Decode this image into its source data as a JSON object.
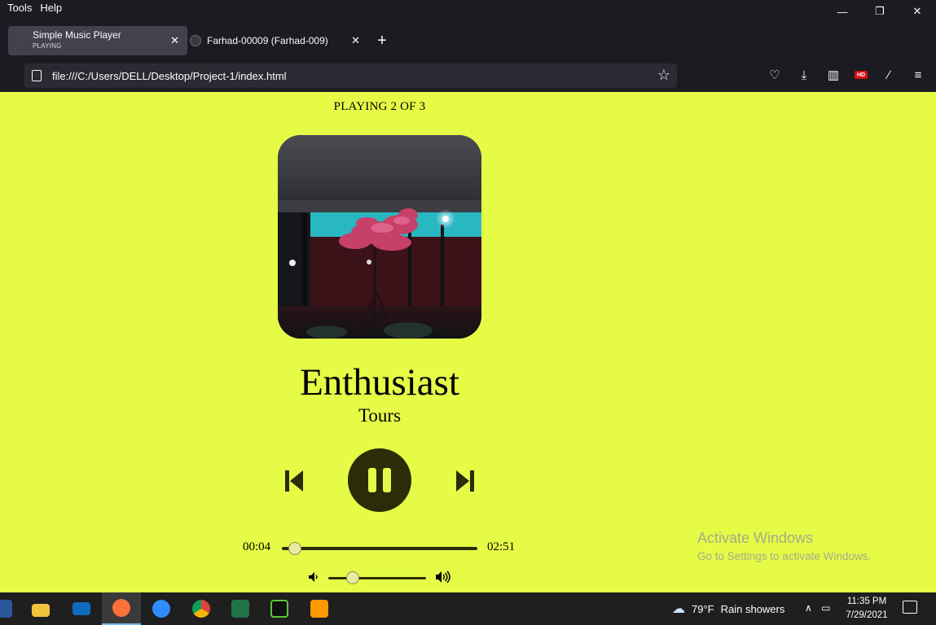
{
  "browser": {
    "menu": [
      "Tools",
      "Help"
    ],
    "tabs": [
      {
        "title": "Simple Music Player",
        "subtitle": "PLAYING"
      },
      {
        "title": "Farhad-00009 (Farhad-009)"
      }
    ],
    "url": "file:///C:/Users/DELL/Desktop/Project-1/index.html",
    "hd_badge": "HD"
  },
  "player": {
    "now_playing": "PLAYING 2 OF 3",
    "track_name": "Enthusiast",
    "artist": "Tours",
    "current_time": "00:04",
    "total_time": "02:51",
    "seek_progress": 0.05,
    "volume_level": 0.25,
    "state": "playing",
    "colors": {
      "background": "#e5fb46",
      "controls": "#2b2d08"
    }
  },
  "watermark": {
    "line1": "Activate Windows",
    "line2": "Go to Settings to activate Windows."
  },
  "taskbar": {
    "apps": [
      "word-icon",
      "file-explorer-icon",
      "mail-icon",
      "firefox-icon",
      "zoom-icon",
      "chrome-icon",
      "excel-icon",
      "terminal-icon",
      "sublime-text-icon"
    ],
    "weather_temp": "79°F",
    "weather_desc": "Rain showers",
    "time": "11:35 PM",
    "date": "7/29/2021"
  }
}
